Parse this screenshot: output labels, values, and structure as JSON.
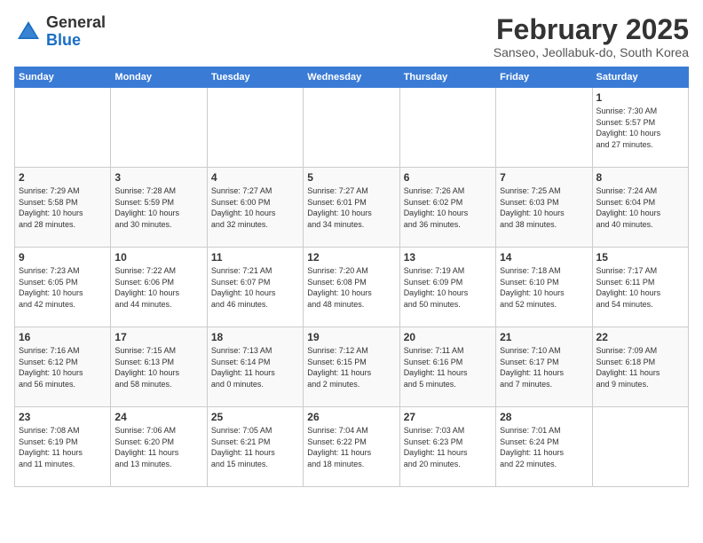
{
  "header": {
    "logo_general": "General",
    "logo_blue": "Blue",
    "month_title": "February 2025",
    "subtitle": "Sanseo, Jeollabuk-do, South Korea"
  },
  "days_of_week": [
    "Sunday",
    "Monday",
    "Tuesday",
    "Wednesday",
    "Thursday",
    "Friday",
    "Saturday"
  ],
  "weeks": [
    [
      {
        "day": "",
        "info": ""
      },
      {
        "day": "",
        "info": ""
      },
      {
        "day": "",
        "info": ""
      },
      {
        "day": "",
        "info": ""
      },
      {
        "day": "",
        "info": ""
      },
      {
        "day": "",
        "info": ""
      },
      {
        "day": "1",
        "info": "Sunrise: 7:30 AM\nSunset: 5:57 PM\nDaylight: 10 hours\nand 27 minutes."
      }
    ],
    [
      {
        "day": "2",
        "info": "Sunrise: 7:29 AM\nSunset: 5:58 PM\nDaylight: 10 hours\nand 28 minutes."
      },
      {
        "day": "3",
        "info": "Sunrise: 7:28 AM\nSunset: 5:59 PM\nDaylight: 10 hours\nand 30 minutes."
      },
      {
        "day": "4",
        "info": "Sunrise: 7:27 AM\nSunset: 6:00 PM\nDaylight: 10 hours\nand 32 minutes."
      },
      {
        "day": "5",
        "info": "Sunrise: 7:27 AM\nSunset: 6:01 PM\nDaylight: 10 hours\nand 34 minutes."
      },
      {
        "day": "6",
        "info": "Sunrise: 7:26 AM\nSunset: 6:02 PM\nDaylight: 10 hours\nand 36 minutes."
      },
      {
        "day": "7",
        "info": "Sunrise: 7:25 AM\nSunset: 6:03 PM\nDaylight: 10 hours\nand 38 minutes."
      },
      {
        "day": "8",
        "info": "Sunrise: 7:24 AM\nSunset: 6:04 PM\nDaylight: 10 hours\nand 40 minutes."
      }
    ],
    [
      {
        "day": "9",
        "info": "Sunrise: 7:23 AM\nSunset: 6:05 PM\nDaylight: 10 hours\nand 42 minutes."
      },
      {
        "day": "10",
        "info": "Sunrise: 7:22 AM\nSunset: 6:06 PM\nDaylight: 10 hours\nand 44 minutes."
      },
      {
        "day": "11",
        "info": "Sunrise: 7:21 AM\nSunset: 6:07 PM\nDaylight: 10 hours\nand 46 minutes."
      },
      {
        "day": "12",
        "info": "Sunrise: 7:20 AM\nSunset: 6:08 PM\nDaylight: 10 hours\nand 48 minutes."
      },
      {
        "day": "13",
        "info": "Sunrise: 7:19 AM\nSunset: 6:09 PM\nDaylight: 10 hours\nand 50 minutes."
      },
      {
        "day": "14",
        "info": "Sunrise: 7:18 AM\nSunset: 6:10 PM\nDaylight: 10 hours\nand 52 minutes."
      },
      {
        "day": "15",
        "info": "Sunrise: 7:17 AM\nSunset: 6:11 PM\nDaylight: 10 hours\nand 54 minutes."
      }
    ],
    [
      {
        "day": "16",
        "info": "Sunrise: 7:16 AM\nSunset: 6:12 PM\nDaylight: 10 hours\nand 56 minutes."
      },
      {
        "day": "17",
        "info": "Sunrise: 7:15 AM\nSunset: 6:13 PM\nDaylight: 10 hours\nand 58 minutes."
      },
      {
        "day": "18",
        "info": "Sunrise: 7:13 AM\nSunset: 6:14 PM\nDaylight: 11 hours\nand 0 minutes."
      },
      {
        "day": "19",
        "info": "Sunrise: 7:12 AM\nSunset: 6:15 PM\nDaylight: 11 hours\nand 2 minutes."
      },
      {
        "day": "20",
        "info": "Sunrise: 7:11 AM\nSunset: 6:16 PM\nDaylight: 11 hours\nand 5 minutes."
      },
      {
        "day": "21",
        "info": "Sunrise: 7:10 AM\nSunset: 6:17 PM\nDaylight: 11 hours\nand 7 minutes."
      },
      {
        "day": "22",
        "info": "Sunrise: 7:09 AM\nSunset: 6:18 PM\nDaylight: 11 hours\nand 9 minutes."
      }
    ],
    [
      {
        "day": "23",
        "info": "Sunrise: 7:08 AM\nSunset: 6:19 PM\nDaylight: 11 hours\nand 11 minutes."
      },
      {
        "day": "24",
        "info": "Sunrise: 7:06 AM\nSunset: 6:20 PM\nDaylight: 11 hours\nand 13 minutes."
      },
      {
        "day": "25",
        "info": "Sunrise: 7:05 AM\nSunset: 6:21 PM\nDaylight: 11 hours\nand 15 minutes."
      },
      {
        "day": "26",
        "info": "Sunrise: 7:04 AM\nSunset: 6:22 PM\nDaylight: 11 hours\nand 18 minutes."
      },
      {
        "day": "27",
        "info": "Sunrise: 7:03 AM\nSunset: 6:23 PM\nDaylight: 11 hours\nand 20 minutes."
      },
      {
        "day": "28",
        "info": "Sunrise: 7:01 AM\nSunset: 6:24 PM\nDaylight: 11 hours\nand 22 minutes."
      },
      {
        "day": "",
        "info": ""
      }
    ]
  ]
}
